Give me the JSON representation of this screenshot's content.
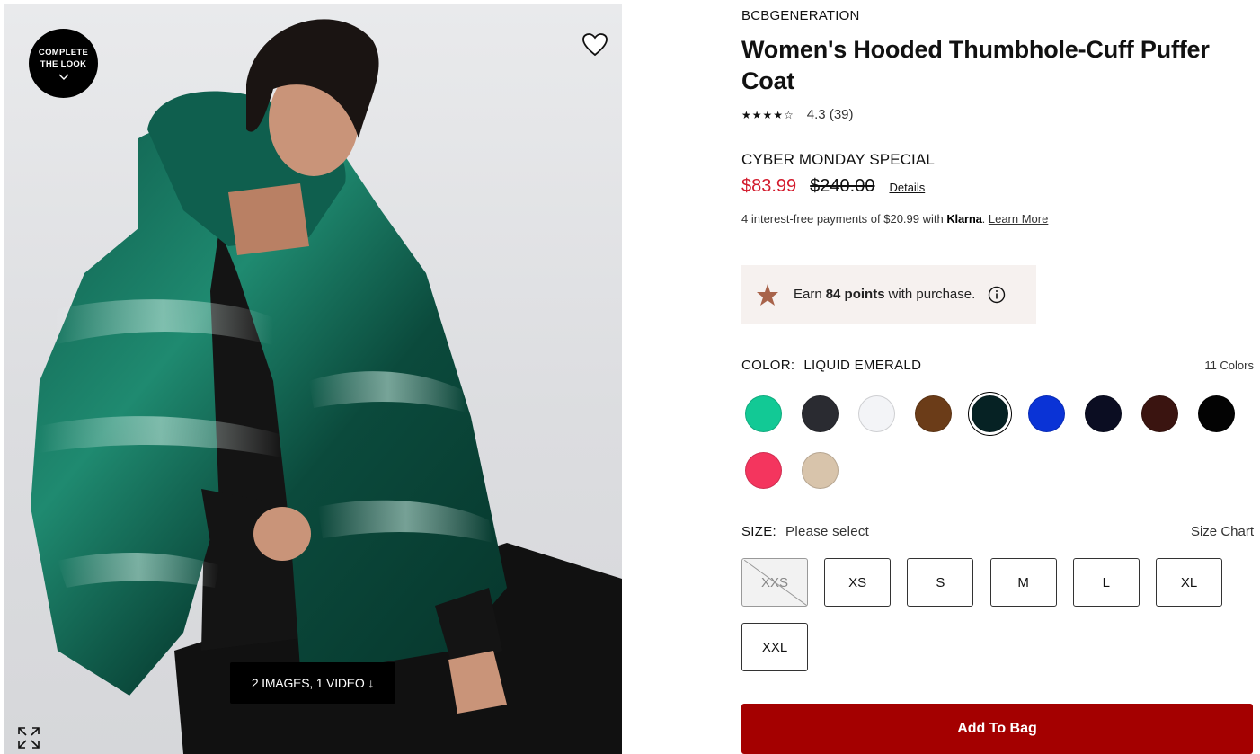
{
  "media": {
    "complete_look_line1": "COMPLETE",
    "complete_look_line2": "THE LOOK",
    "media_count": "2 IMAGES, 1 VIDEO ↓",
    "icons": [
      "chevron-down-icon",
      "heart-icon",
      "expand-icon"
    ]
  },
  "product": {
    "brand": "BCBGENERATION",
    "title": "Women's Hooded Thumbhole-Cuff Puffer Coat",
    "stars": "★★★★☆",
    "rating": "4.3",
    "review_count": "39",
    "promo_label": "CYBER MONDAY SPECIAL",
    "sale_price": "$83.99",
    "original_price": "$240.00",
    "details_link": "Details",
    "klarna": {
      "prefix": "4 interest-free payments of $20.99 with",
      "brand": "Klarna",
      "learn_more": "Learn More"
    },
    "points": {
      "earn": "Earn",
      "amount": "84 points",
      "suffix": "with purchase."
    },
    "color": {
      "label": "COLOR:",
      "selected": "LIQUID EMERALD",
      "count": "11 Colors",
      "swatches": [
        "#12c995",
        "#2a2b31",
        "#f3f4f7",
        "#6b3c18",
        "#062224",
        "#0a33d6",
        "#0b0d22",
        "#3a1410",
        "#030303",
        "#f4355e",
        "#d8c4ab"
      ],
      "selected_index": 4
    },
    "size": {
      "label": "SIZE:",
      "selected": "Please select",
      "size_chart": "Size Chart",
      "options": [
        "XXS",
        "XS",
        "S",
        "M",
        "L",
        "XL",
        "XXL"
      ],
      "unavailable": [
        "XXS"
      ]
    },
    "add_to_bag": "Add To Bag",
    "accent_color": "#a40000",
    "sale_color": "#d31b2d"
  }
}
